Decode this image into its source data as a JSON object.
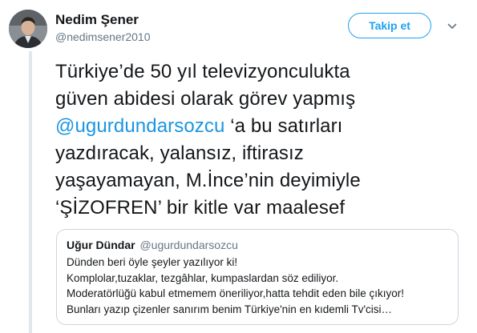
{
  "author": {
    "name": "Nedim Şener",
    "handle": "@nedimsener2010"
  },
  "follow_button_label": "Takip et",
  "tweet": {
    "line1": "Türkiye’de 50 yıl televizyonculukta",
    "line2": "güven abidesi olarak görev yapmış",
    "mention": "@ugurdundarsozcu",
    "line3_rest": " ‘a bu satırları",
    "line4": "yazdıracak, yalansız, iftirasız",
    "line5": "yaşayamayan, M.İnce’nin deyimiyle",
    "line6": "‘ŞİZOFREN’ bir kitle var maalesef"
  },
  "quoted_tweet": {
    "name": "Uğur Dündar",
    "handle": "@ugurdundarsozcu",
    "lines": [
      "Dünden beri öyle şeyler yazılıyor ki!",
      "Komplolar,tuzaklar, tezgâhlar, kumpaslardan söz ediliyor.",
      "Moderatörlüğü kabul etmemem öneriliyor,hatta tehdit eden bile çıkıyor!",
      "Bunları yazıp çizenler sanırım benim Türkiye'nin en kıdemli Tv'cisi…"
    ]
  },
  "icons": {
    "avatar": "profile-photo",
    "caret": "chevron-down-icon"
  },
  "colors": {
    "accent": "#1da1f2",
    "mention": "#1b95e0",
    "secondary_text": "#657786",
    "border": "#ccd6dd"
  }
}
